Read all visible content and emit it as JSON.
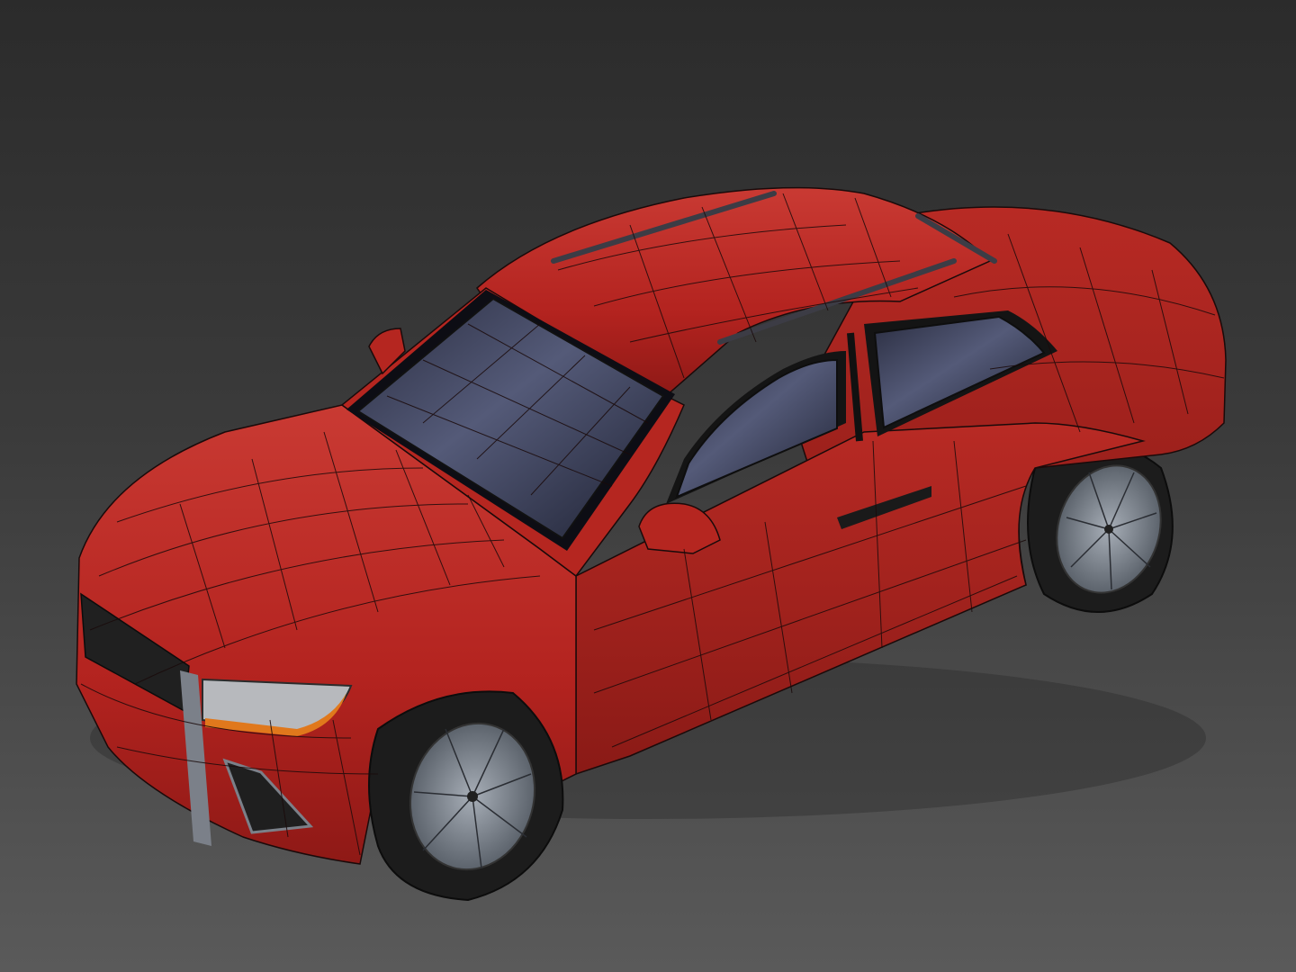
{
  "scene": {
    "subject": "car-model",
    "view": "perspective",
    "shading": "textured-with-wireframe-edges"
  },
  "colors": {
    "background_top": "#2b2b2b",
    "background_bottom": "#5a5a5a",
    "body_paint": "#b3231f",
    "body_paint_dark": "#7e1512",
    "body_paint_light": "#c93a33",
    "wire": "#1a0a0a",
    "glass": "#3a3e55",
    "glass_light": "#5a5f80",
    "glass_dark": "#1c1e2e",
    "trim": "#1a1a1a",
    "tire": "#1c1c1c",
    "rim": "#6f7680",
    "rim_light": "#9aa2ac",
    "headlight": "#b7b9bd",
    "indicator": "#e0781c",
    "grille": "#202020",
    "chrome": "#7b8089"
  }
}
